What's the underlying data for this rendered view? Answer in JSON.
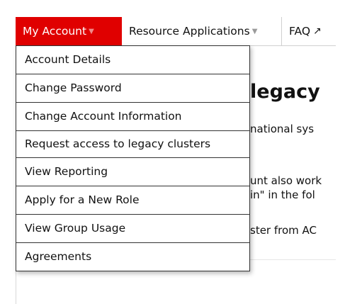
{
  "navbar": {
    "my_account": "My Account",
    "resource_applications": "Resource Applications",
    "faq": "FAQ",
    "active_color": "#e00000"
  },
  "dropdown": {
    "items": [
      "Account Details",
      "Change Password",
      "Change Account Information",
      "Request access to legacy clusters",
      "View Reporting",
      "Apply for a New Role",
      "View Group Usage",
      "Agreements"
    ]
  },
  "background": {
    "heading_fragment": "legacy",
    "line1": "national sys",
    "line2": "unt also work",
    "line3": "in\" in the fol",
    "line4": "ster from AC"
  }
}
